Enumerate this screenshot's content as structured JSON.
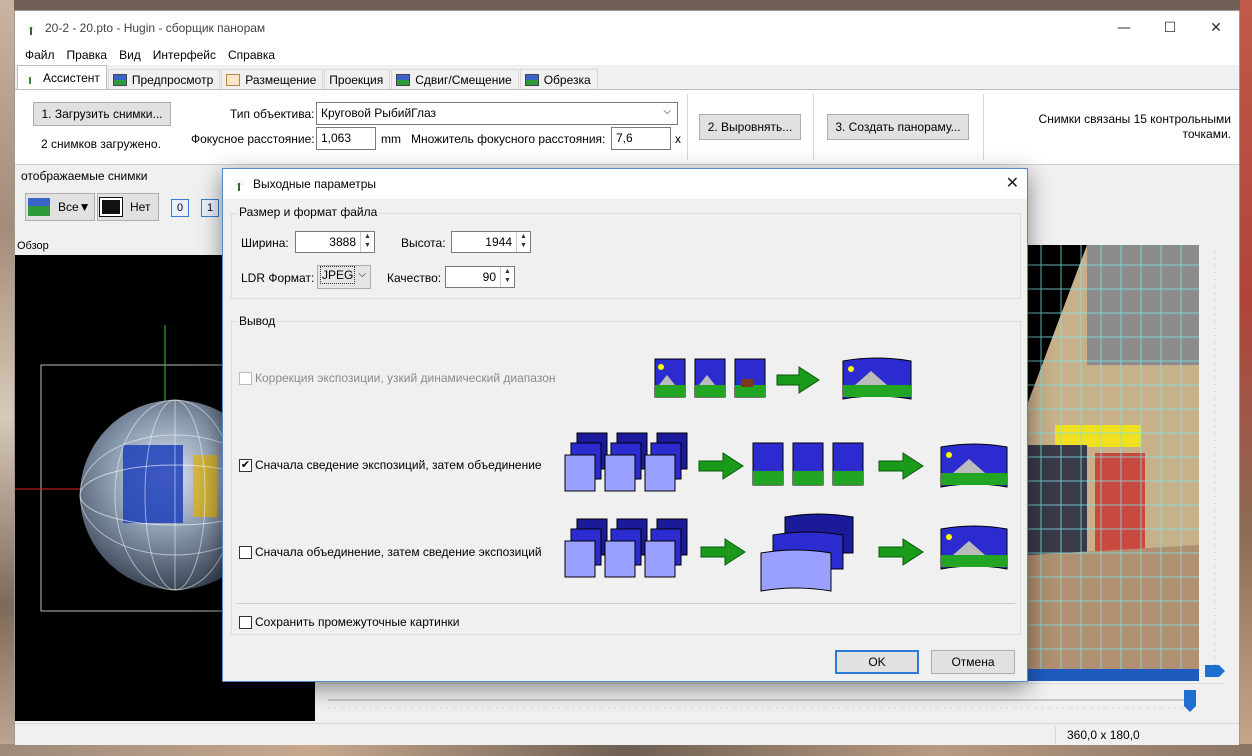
{
  "window": {
    "title": "20-2 - 20.pto - Hugin - сборщик панорам",
    "controls": {
      "minimize": "—",
      "maximize": "☐",
      "close": "✕"
    }
  },
  "menu": [
    "Файл",
    "Правка",
    "Вид",
    "Интерфейс",
    "Справка"
  ],
  "tabs": [
    {
      "label": "Ассистент",
      "active": true
    },
    {
      "label": "Предпросмотр"
    },
    {
      "label": "Размещение"
    },
    {
      "label": "Проекция"
    },
    {
      "label": "Сдвиг/Смещение"
    },
    {
      "label": "Обрезка"
    }
  ],
  "assistant": {
    "load_button": "1. Загрузить снимки...",
    "loaded_text": "2 снимков загружено.",
    "lens_type_label": "Тип объектива:",
    "lens_type_value": "Круговой РыбийГлаз",
    "focal_label": "Фокусное расстояние:",
    "focal_value": "1,063",
    "focal_unit": "mm",
    "crop_label": "Множитель фокусного расстояния:",
    "crop_value": "7,6",
    "crop_unit": "x",
    "align_button": "2. Выровнять...",
    "create_button": "3. Создать панораму...",
    "status_line1": "Снимки связаны 15 контрольными",
    "status_line2": "точками."
  },
  "images": {
    "label": "отображаемые снимки",
    "all_button": "Все▼",
    "none_button": "Нет",
    "numbers": [
      "0",
      "1"
    ]
  },
  "overview": {
    "label": "Обзор"
  },
  "status": {
    "fov": "360,0 x 180,0"
  },
  "dialog": {
    "title": "Выходные параметры",
    "size_group": "Размер и формат файла",
    "width_label": "Ширина:",
    "width_value": "3888",
    "height_label": "Высота:",
    "height_value": "1944",
    "format_label": "LDR Формат:",
    "format_value": "JPEG",
    "quality_label": "Качество:",
    "quality_value": "90",
    "output_group": "Вывод",
    "option1": {
      "label": "Коррекция экспозиции, узкий динамический диапазон",
      "checked": false,
      "enabled": false
    },
    "option2": {
      "label": "Сначала сведение экспозиций, затем объединение",
      "checked": true,
      "enabled": true
    },
    "option3": {
      "label": "Сначала объединение, затем сведение экспозиций",
      "checked": false,
      "enabled": true
    },
    "save_intermediate": {
      "label": "Сохранить промежуточные картинки",
      "checked": false
    },
    "ok_button": "OK",
    "cancel_button": "Отмена"
  }
}
